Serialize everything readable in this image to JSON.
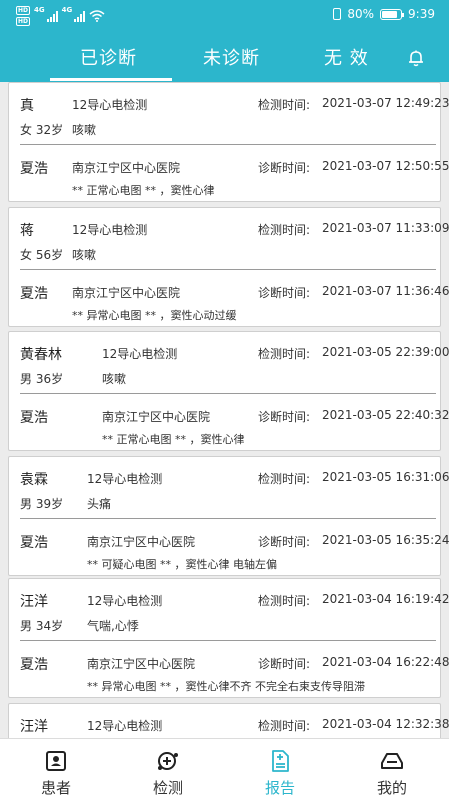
{
  "status_bar": {
    "hd1": "HD",
    "hd2": "HD",
    "net1": "4G",
    "net2": "4G",
    "battery_percent": "80%",
    "time": "9:39"
  },
  "tabs": [
    {
      "label": "已诊断",
      "active": true
    },
    {
      "label": "未诊断",
      "active": false
    },
    {
      "label": "无 效",
      "active": false
    }
  ],
  "reports": [
    {
      "name": "真",
      "test_type": "12导心电检测",
      "test_time_label": "检测时间:",
      "test_time": "2021-03-07 12:49:23",
      "gender_age": "女 32岁",
      "symptom": "咳嗽",
      "doctor": "夏浩",
      "hospital": "南京江宁区中心医院",
      "diag_time_label": "诊断时间:",
      "diag_time": "2021-03-07 12:50:55",
      "result": "** 正常心电图 ** ，窦性心律"
    },
    {
      "name": "蒋",
      "test_type": "12导心电检测",
      "test_time_label": "检测时间:",
      "test_time": "2021-03-07 11:33:09",
      "gender_age": "女 56岁",
      "symptom": "咳嗽",
      "doctor": "夏浩",
      "hospital": "南京江宁区中心医院",
      "diag_time_label": "诊断时间:",
      "diag_time": "2021-03-07 11:36:46",
      "result": "** 异常心电图 ** ，窦性心动过缓"
    },
    {
      "name": "黄春林",
      "test_type": "12导心电检测",
      "test_time_label": "检测时间:",
      "test_time": "2021-03-05 22:39:00",
      "gender_age": "男 36岁",
      "symptom": "咳嗽",
      "doctor": "夏浩",
      "hospital": "南京江宁区中心医院",
      "diag_time_label": "诊断时间:",
      "diag_time": "2021-03-05 22:40:32",
      "result": "** 正常心电图 ** ，窦性心律"
    },
    {
      "name": "袁霖",
      "test_type": "12导心电检测",
      "test_time_label": "检测时间:",
      "test_time": "2021-03-05 16:31:06",
      "gender_age": "男 39岁",
      "symptom": "头痛",
      "doctor": "夏浩",
      "hospital": "南京江宁区中心医院",
      "diag_time_label": "诊断时间:",
      "diag_time": "2021-03-05 16:35:24",
      "result": "** 可疑心电图 ** ，窦性心律 电轴左偏"
    },
    {
      "name": "汪洋",
      "test_type": "12导心电检测",
      "test_time_label": "检测时间:",
      "test_time": "2021-03-04 16:19:42",
      "gender_age": "男 34岁",
      "symptom": "气喘,心悸",
      "doctor": "夏浩",
      "hospital": "南京江宁区中心医院",
      "diag_time_label": "诊断时间:",
      "diag_time": "2021-03-04 16:22:48",
      "result": "** 异常心电图 ** ，窦性心律不齐 不完全右束支传导阻滞"
    },
    {
      "name": "汪洋",
      "test_type": "12导心电检测",
      "test_time_label": "检测时间:",
      "test_time": "2021-03-04 12:32:38"
    }
  ],
  "bottom_nav": [
    {
      "label": "患者",
      "icon": "patient-icon",
      "active": false
    },
    {
      "label": "检测",
      "icon": "test-icon",
      "active": false
    },
    {
      "label": "报告",
      "icon": "report-icon",
      "active": true
    },
    {
      "label": "我的",
      "icon": "mine-icon",
      "active": false
    }
  ],
  "colors": {
    "accent": "#2cb6cc",
    "card_bg": "#ffffff",
    "page_bg": "#ececec"
  }
}
